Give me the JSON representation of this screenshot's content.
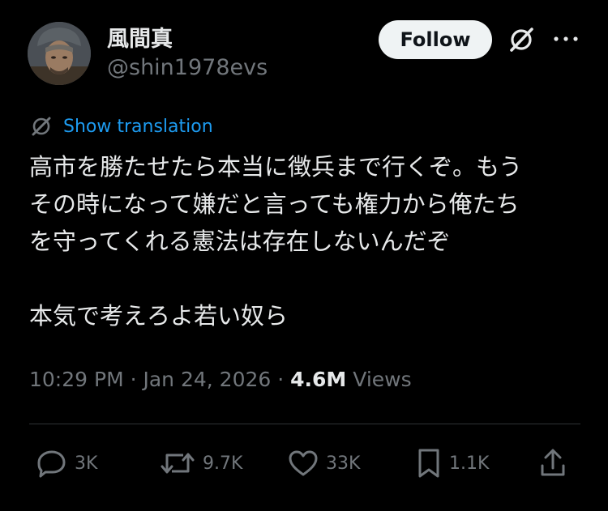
{
  "user": {
    "display_name": "風間真",
    "handle": "@shin1978evs"
  },
  "header": {
    "follow_label": "Follow",
    "grok_icon": "grok-icon",
    "more_icon": "more-icon"
  },
  "translation": {
    "icon": "grok-icon",
    "label": "Show translation"
  },
  "tweet": {
    "lines": [
      "高市を勝たせたら本当に徴兵まで行くぞ。もう",
      "その時になって嫌だと言っても権力から俺たち",
      "を守ってくれる憲法は存在しないんだぞ",
      "",
      "本気で考えろよ若い奴ら"
    ]
  },
  "meta": {
    "time": "10:29 PM",
    "separator": " · ",
    "date": "Jan 24, 2026",
    "views_count": "4.6M",
    "views_label": "Views"
  },
  "actions": {
    "reply": {
      "icon": "reply-icon",
      "count": "3K"
    },
    "repost": {
      "icon": "repost-icon",
      "count": "9.7K"
    },
    "like": {
      "icon": "heart-icon",
      "count": "33K"
    },
    "bookmark": {
      "icon": "bookmark-icon",
      "count": "1.1K"
    },
    "share": {
      "icon": "share-icon"
    }
  },
  "colors": {
    "background": "#000000",
    "text_primary": "#e7e9ea",
    "text_secondary": "#71767b",
    "link": "#1d9bf0",
    "follow_bg": "#eff3f4",
    "divider": "#2f3336"
  }
}
